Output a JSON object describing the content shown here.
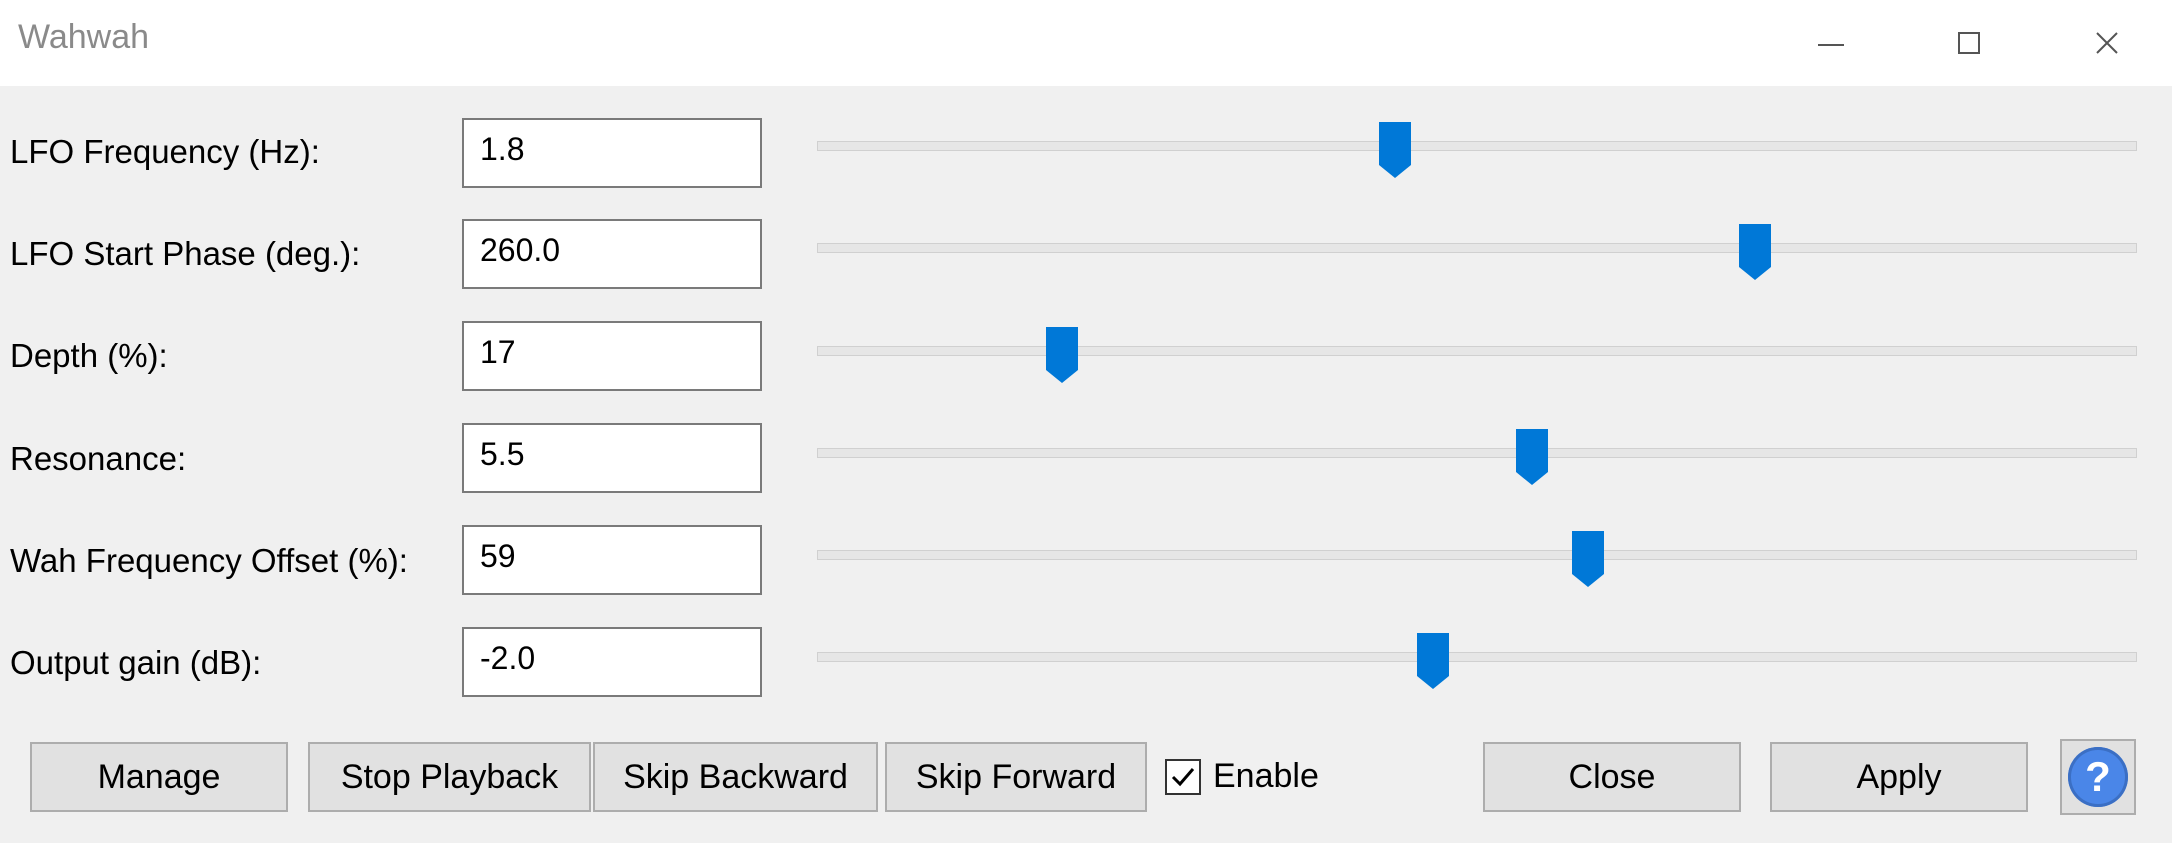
{
  "window": {
    "title": "Wahwah",
    "controls": {
      "minimize_icon": "minimize-icon",
      "maximize_icon": "maximize-icon",
      "close_icon": "close-icon"
    }
  },
  "params": [
    {
      "label": "LFO Frequency (Hz):",
      "value": "1.8",
      "slider_fraction": 0.436
    },
    {
      "label": "LFO Start Phase (deg.):",
      "value": "260.0",
      "slider_fraction": 0.716
    },
    {
      "label": "Depth (%):",
      "value": "17",
      "slider_fraction": 0.177
    },
    {
      "label": "Resonance:",
      "value": "5.5",
      "slider_fraction": 0.543
    },
    {
      "label": "Wah Frequency Offset (%):",
      "value": "59",
      "slider_fraction": 0.586
    },
    {
      "label": "Output gain (dB):",
      "value": "-2.0",
      "slider_fraction": 0.466
    }
  ],
  "buttons": {
    "manage": "Manage",
    "stop_playback": "Stop Playback",
    "skip_backward": "Skip Backward",
    "skip_forward": "Skip Forward",
    "enable_label": "Enable",
    "enable_checked": true,
    "close": "Close",
    "apply": "Apply",
    "help_glyph": "?"
  },
  "colors": {
    "thumb": "#0078d7",
    "help": "#4a86e8"
  }
}
